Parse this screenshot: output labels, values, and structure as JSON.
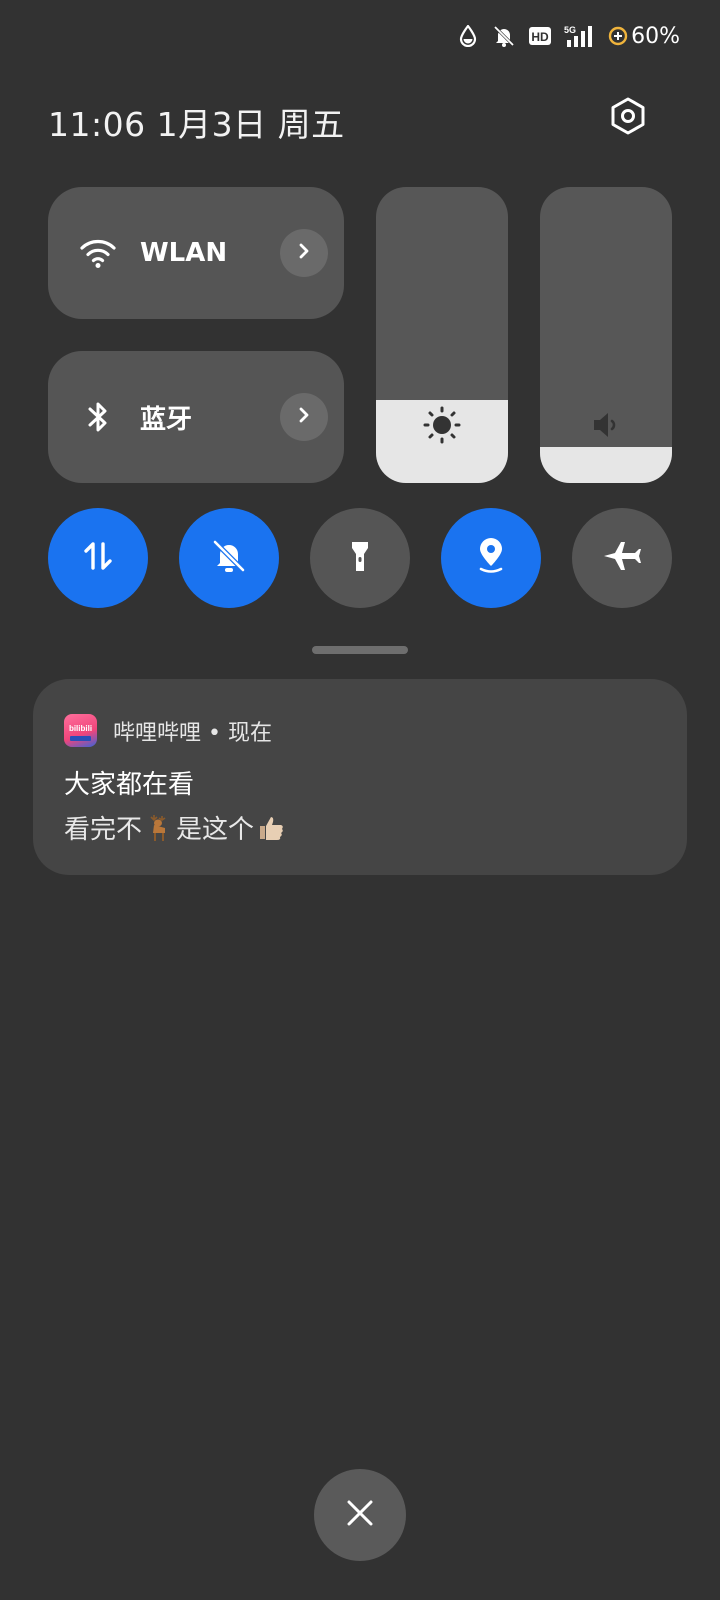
{
  "status_bar": {
    "icons": [
      "water-drop-icon",
      "bell-off-icon",
      "hd-icon",
      "signal-5g-icon",
      "battery-charging-icon"
    ],
    "hd_label": "HD",
    "network_label": "5G",
    "battery_text": "60%"
  },
  "header": {
    "datetime": "11:06  1月3日 周五",
    "settings_icon": "settings-hex-icon"
  },
  "tiles": [
    {
      "label": "WLAN",
      "icon": "wifi-icon"
    },
    {
      "label": "蓝牙",
      "icon": "bluetooth-icon"
    }
  ],
  "sliders": {
    "brightness": {
      "icon": "sun-icon",
      "level": 0.28
    },
    "volume": {
      "icon": "speaker-icon",
      "level": 0.12
    }
  },
  "toggles": [
    {
      "icon": "mobile-data-icon",
      "active": true
    },
    {
      "icon": "mute-bell-icon",
      "active": true
    },
    {
      "icon": "flashlight-icon",
      "active": false
    },
    {
      "icon": "location-icon",
      "active": true
    },
    {
      "icon": "airplane-icon",
      "active": false
    }
  ],
  "notification": {
    "app_name": "哔哩哔哩 • 现在",
    "icon_text": "bilibili",
    "title": "大家都在看",
    "body_part1": "看完不",
    "body_part2": "是这个",
    "emojis": [
      "deer-emoji",
      "thumbs-up-emoji"
    ]
  },
  "colors": {
    "background": "#323232",
    "active_toggle": "#1a73f0",
    "inactive": "#555555"
  },
  "close_icon": "close-icon"
}
